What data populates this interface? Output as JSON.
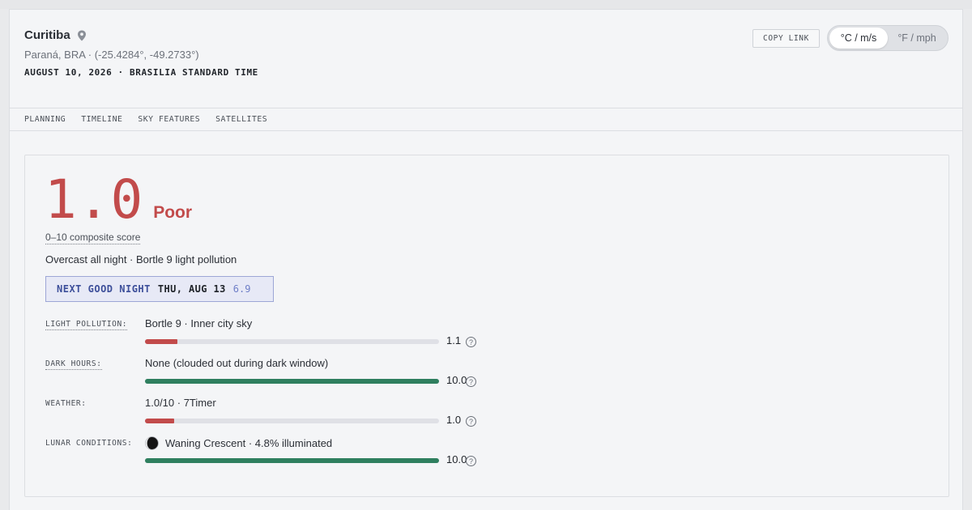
{
  "location": {
    "city": "Curitiba",
    "region_coords": "Paraná, BRA · (-25.4284°, -49.2733°)",
    "date_tz": "AUGUST 10, 2026 · BRASILIA STANDARD TIME"
  },
  "actions": {
    "copy_link": "COPY LINK",
    "units": [
      {
        "label": "°C / m/s",
        "active": true
      },
      {
        "label": "°F / mph",
        "active": false
      }
    ]
  },
  "tabs": [
    "PLANNING",
    "TIMELINE",
    "SKY FEATURES",
    "SATELLITES"
  ],
  "score": {
    "value": "1.0",
    "grade": "Poor",
    "composite_label": "0–10 composite score",
    "summary": "Overcast all night · Bortle 9 light pollution",
    "color": "#c24b4b"
  },
  "next_good_night": {
    "label": "NEXT GOOD NIGHT",
    "date": "THU, AUG 13",
    "score": "6.9"
  },
  "factors": [
    {
      "label": "LIGHT POLLUTION:",
      "text": "Bortle 9 · Inner city sky",
      "value": "1.1",
      "fraction": 0.11,
      "color": "#c24b4b",
      "icon": ""
    },
    {
      "label": "DARK HOURS:",
      "text": "None (clouded out during dark window)",
      "value": "10.0",
      "fraction": 1.0,
      "color": "#2f7f5f",
      "icon": ""
    },
    {
      "label": "WEATHER:",
      "text": "1.0/10 · 7Timer",
      "value": "1.0",
      "fraction": 0.1,
      "color": "#c24b4b",
      "icon": ""
    },
    {
      "label": "LUNAR CONDITIONS:",
      "text": "Waning Crescent · 4.8% illuminated",
      "value": "10.0",
      "fraction": 1.0,
      "color": "#2f7f5f",
      "icon": "moon-icon"
    }
  ],
  "help_glyph": "?"
}
